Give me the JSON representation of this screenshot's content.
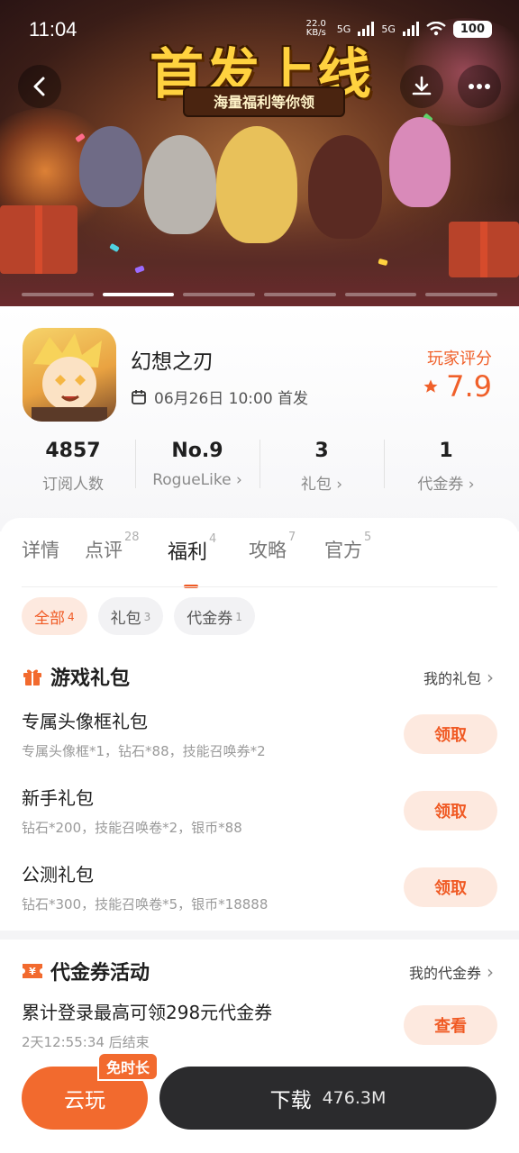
{
  "status_bar": {
    "time": "11:04",
    "net_speed": "22.0 KB/s",
    "signal_1": "5G",
    "signal_2": "5G",
    "battery": "100"
  },
  "banner": {
    "title": "首发上线",
    "subtitle": "海量福利等你领",
    "slides_total": 6,
    "active_slide": 2
  },
  "app": {
    "name": "幻想之刃",
    "release": "06月26日 10:00 首发",
    "rating_label": "玩家评分",
    "rating_value": "7.9"
  },
  "stats": [
    {
      "value": "4857",
      "label": "订阅人数"
    },
    {
      "value": "No.9",
      "label": "RogueLike"
    },
    {
      "value": "3",
      "label": "礼包"
    },
    {
      "value": "1",
      "label": "代金券"
    }
  ],
  "tabs": [
    {
      "label": "详情",
      "count": ""
    },
    {
      "label": "点评",
      "count": "28"
    },
    {
      "label": "福利",
      "count": "4"
    },
    {
      "label": "攻略",
      "count": "7"
    },
    {
      "label": "官方",
      "count": "5"
    }
  ],
  "filters": [
    {
      "label": "全部",
      "count": "4"
    },
    {
      "label": "礼包",
      "count": "3"
    },
    {
      "label": "代金券",
      "count": "1"
    }
  ],
  "gift_section": {
    "title": "游戏礼包",
    "link": "我的礼包",
    "items": [
      {
        "name": "专属头像框礼包",
        "desc": "专属头像框*1，钻石*88，技能召唤券*2",
        "button": "领取"
      },
      {
        "name": "新手礼包",
        "desc": "钻石*200，技能召唤卷*2，银币*88",
        "button": "领取"
      },
      {
        "name": "公测礼包",
        "desc": "钻石*300，技能召唤卷*5，银币*18888",
        "button": "领取"
      }
    ]
  },
  "voucher_section": {
    "title": "代金券活动",
    "link": "我的代金券",
    "item": {
      "name": "累计登录最高可领298元代金券",
      "desc": "2天12:55:34 后结束",
      "button": "查看"
    }
  },
  "bottom": {
    "cloud_label": "云玩",
    "free_badge": "免时长",
    "download_label": "下载",
    "download_size": "476.3M"
  },
  "colors": {
    "accent": "#f05a24",
    "accent_light": "#fde9df",
    "dark_button": "#2b2b2d"
  }
}
